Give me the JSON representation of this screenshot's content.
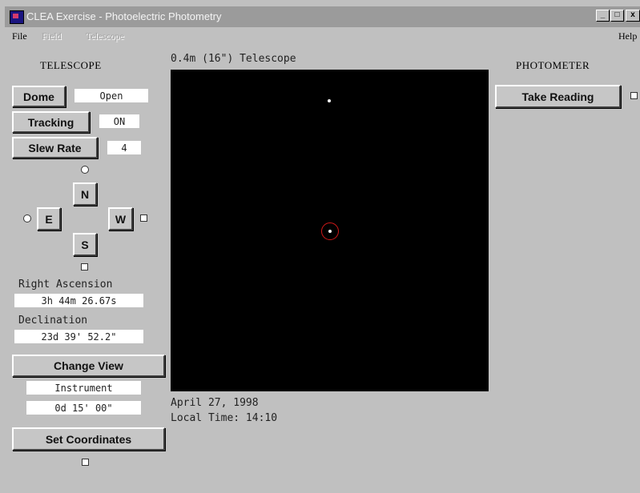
{
  "window": {
    "title": "CLEA Exercise - Photoelectric Photometry",
    "minimize_glyph": "_",
    "maximize_glyph": "□",
    "close_glyph": "x"
  },
  "menu": {
    "file": "File",
    "field": "Field",
    "telescope": "Telescope",
    "help": "Help"
  },
  "telescope_panel": {
    "heading": "TELESCOPE",
    "dome_label": "Dome",
    "dome_value": "Open",
    "tracking_label": "Tracking",
    "tracking_value": "ON",
    "slew_label": "Slew Rate",
    "slew_value": "4",
    "north": "N",
    "south": "S",
    "east": "E",
    "west": "W",
    "ra_label": "Right Ascension",
    "ra_value": "3h 44m 26.67s",
    "dec_label": "Declination",
    "dec_value": "23d 39' 52.2\"",
    "change_view": "Change View",
    "view_mode": "Instrument",
    "view_field": "0d 15' 00\"",
    "set_coordinates": "Set Coordinates"
  },
  "view": {
    "title": "0.4m (16\") Telescope",
    "date": "April 27, 1998",
    "local_time": "Local Time: 14:10"
  },
  "photometer": {
    "heading": "PHOTOMETER",
    "take_reading": "Take Reading"
  },
  "colors": {
    "background": "#c0c0c0",
    "sky": "#000000",
    "reticle": "#d01818",
    "title_bar": "#9b9b9b"
  }
}
